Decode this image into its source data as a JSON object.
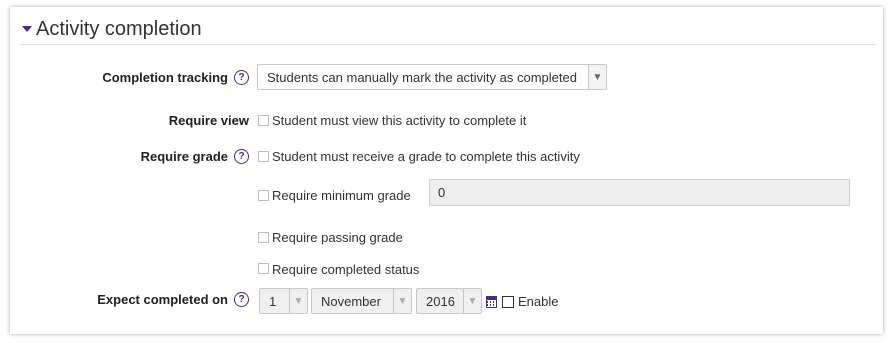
{
  "section": {
    "title": "Activity completion"
  },
  "completion_tracking": {
    "label": "Completion tracking",
    "help": "?",
    "value": "Students can manually mark the activity as completed"
  },
  "require_view": {
    "label": "Require view",
    "checkbox_label": "Student must view this activity to complete it"
  },
  "require_grade": {
    "label": "Require grade",
    "help": "?",
    "checkbox_label": "Student must receive a grade to complete this activity"
  },
  "minimum_grade": {
    "checkbox_label": "Require minimum grade",
    "value": "0"
  },
  "passing_grade": {
    "checkbox_label": "Require passing grade"
  },
  "completed_status": {
    "checkbox_label": "Require completed status"
  },
  "expect_completed": {
    "label": "Expect completed on",
    "help": "?",
    "day": "1",
    "month": "November",
    "year": "2016",
    "enable_label": "Enable"
  },
  "icons": {
    "caret": "caret-down-icon",
    "help": "help-circle-icon",
    "calendar": "calendar-icon",
    "dropdown": "chevron-down-icon"
  },
  "colors": {
    "accent": "#4b2d7f"
  }
}
